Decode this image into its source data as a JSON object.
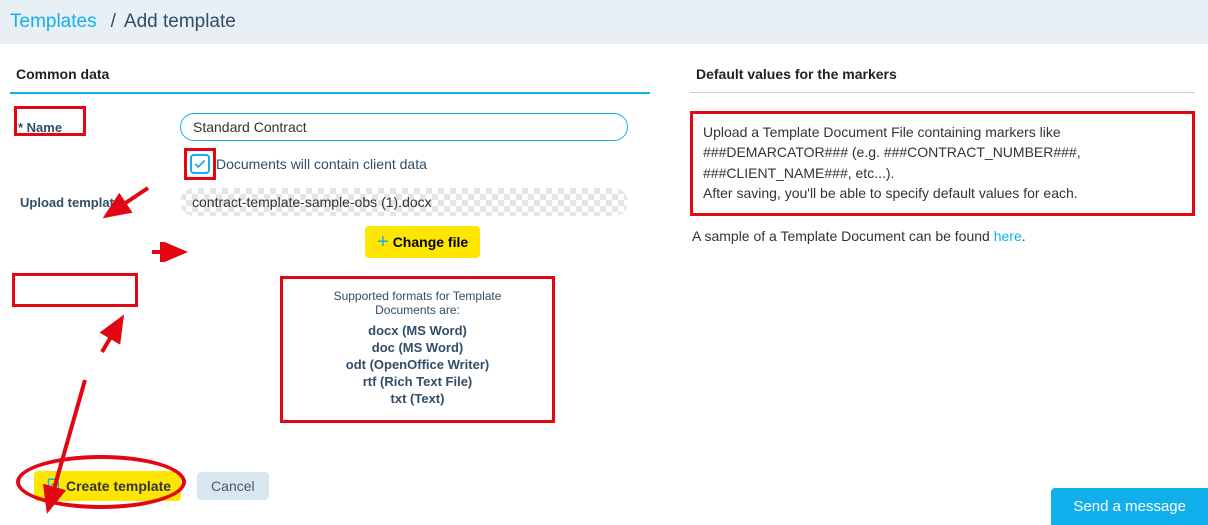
{
  "breadcrumb": {
    "parent": "Templates",
    "separator": "/",
    "current": "Add template"
  },
  "left": {
    "section_title": "Common data",
    "name_label": "* Name",
    "name_value": "Standard Contract",
    "client_data_label": "Documents will contain client data",
    "client_data_checked": true,
    "upload_label": "Upload template",
    "file_name": "contract-template-sample-obs (1).docx",
    "change_file_label": "Change file",
    "supported": {
      "header": "Supported formats for Template Documents are:",
      "formats": [
        "docx (MS Word)",
        "doc (MS Word)",
        "odt (OpenOffice Writer)",
        "rtf (Rich Text File)",
        "txt (Text)"
      ]
    },
    "create_label": "Create template",
    "cancel_label": "Cancel"
  },
  "right": {
    "section_title": "Default values for the markers",
    "instructions_line1": "Upload a Template Document File containing markers like ###DEMARCATOR### (e.g. ###CONTRACT_NUMBER###, ###CLIENT_NAME###, etc...).",
    "instructions_line2": "After saving, you'll be able to specify default values for each.",
    "sample_prefix": "A sample of a Template Document can be found ",
    "sample_link": "here",
    "sample_suffix": "."
  },
  "chat": {
    "label": "Send a message"
  }
}
